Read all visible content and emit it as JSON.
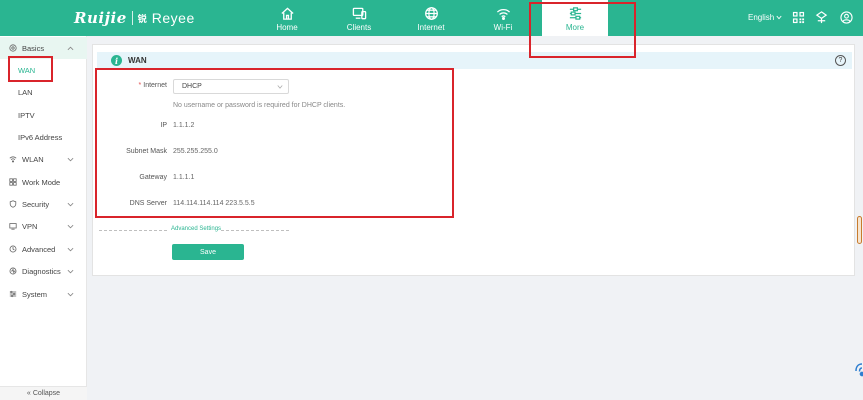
{
  "brand": {
    "name": "Ruijie",
    "sub_mark": "锐",
    "sub_name": "Reyee"
  },
  "nav_tabs": [
    {
      "label": "Home",
      "icon": "home-icon"
    },
    {
      "label": "Clients",
      "icon": "clients-icon"
    },
    {
      "label": "Internet",
      "icon": "globe-icon"
    },
    {
      "label": "Wi-Fi",
      "icon": "wifi-icon"
    },
    {
      "label": "More",
      "icon": "more-icon",
      "active": true
    }
  ],
  "topright": {
    "language": "English",
    "icons": [
      "qr-code-icon",
      "network-icon",
      "user-icon"
    ]
  },
  "sidebar": {
    "groups": [
      {
        "label": "Basics",
        "icon": "basics-icon",
        "expanded": true,
        "items": [
          "WAN",
          "LAN",
          "IPTV",
          "IPv6 Address"
        ],
        "active_item": "WAN"
      },
      {
        "label": "WLAN",
        "icon": "wifi-icon"
      },
      {
        "label": "Work Mode",
        "icon": "work-mode-icon"
      },
      {
        "label": "Security",
        "icon": "shield-icon"
      },
      {
        "label": "VPN",
        "icon": "vpn-icon"
      },
      {
        "label": "Advanced",
        "icon": "advanced-icon"
      },
      {
        "label": "Diagnostics",
        "icon": "diagnostics-icon"
      },
      {
        "label": "System",
        "icon": "system-icon"
      }
    ],
    "collapse_label": "Collapse"
  },
  "card": {
    "title": "WAN",
    "internet": {
      "label": "Internet",
      "required_mark": "*",
      "value": "DHCP"
    },
    "hint": "No username or password is required for DHCP clients.",
    "fields": [
      {
        "label": "IP",
        "value": "1.1.1.2"
      },
      {
        "label": "Subnet Mask",
        "value": "255.255.255.0"
      },
      {
        "label": "Gateway",
        "value": "1.1.1.1"
      },
      {
        "label": "DNS Server",
        "value": "114.114.114.114 223.5.5.5"
      }
    ],
    "advanced_settings": "Advanced Settings",
    "save_label": "Save"
  },
  "colors": {
    "brand_green": "#2ab591",
    "annotation_red": "#d9242b",
    "header_tint": "#e6f4fa"
  }
}
